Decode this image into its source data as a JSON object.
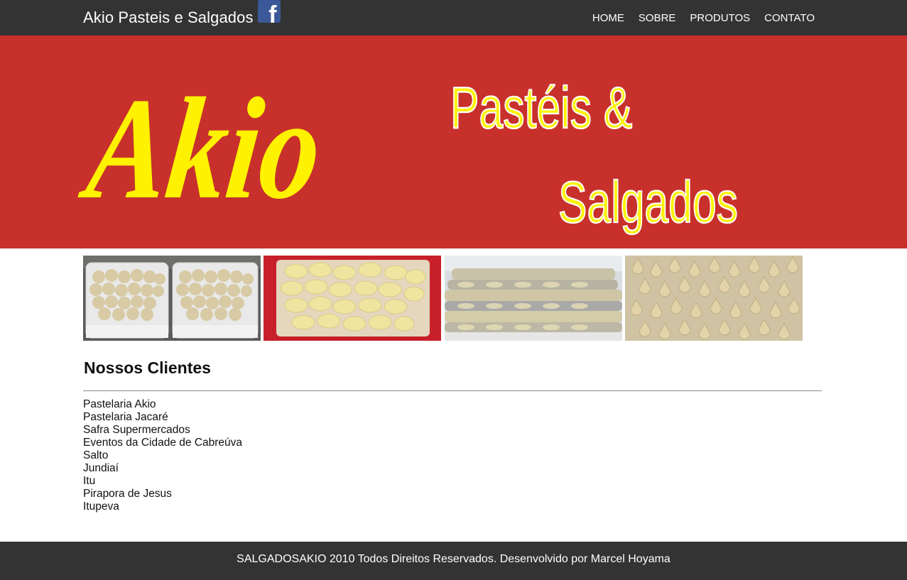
{
  "header": {
    "brand_title": "Akio Pasteis e Salgados",
    "facebook_icon": "facebook-icon",
    "nav": [
      {
        "label": "HOME"
      },
      {
        "label": "SOBRE"
      },
      {
        "label": "PRODUTOS"
      },
      {
        "label": "CONTATO"
      }
    ]
  },
  "banner": {
    "logo_text": "Akio",
    "tagline_line1": "Pastéis &",
    "tagline_line2": "Salgados",
    "background_color": "#c8302c",
    "text_color": "#fff200"
  },
  "photos": [
    {
      "name": "photo-trays-of-salgados"
    },
    {
      "name": "photo-bagged-pasteis"
    },
    {
      "name": "photo-stacked-pastry-packs"
    },
    {
      "name": "photo-coxinhas"
    }
  ],
  "clients": {
    "title": "Nossos Clientes",
    "items": [
      "Pastelaria Akio",
      "Pastelaria Jacaré",
      "Safra Supermercados",
      "Eventos da Cidade de Cabreúva",
      "Salto",
      "Jundiaí",
      "Itu",
      "Pirapora de Jesus",
      "Itupeva"
    ]
  },
  "footer": {
    "text": "SALGADOSAKIO 2010 Todos Direitos Reservados. Desenvolvido por Marcel Hoyama"
  }
}
